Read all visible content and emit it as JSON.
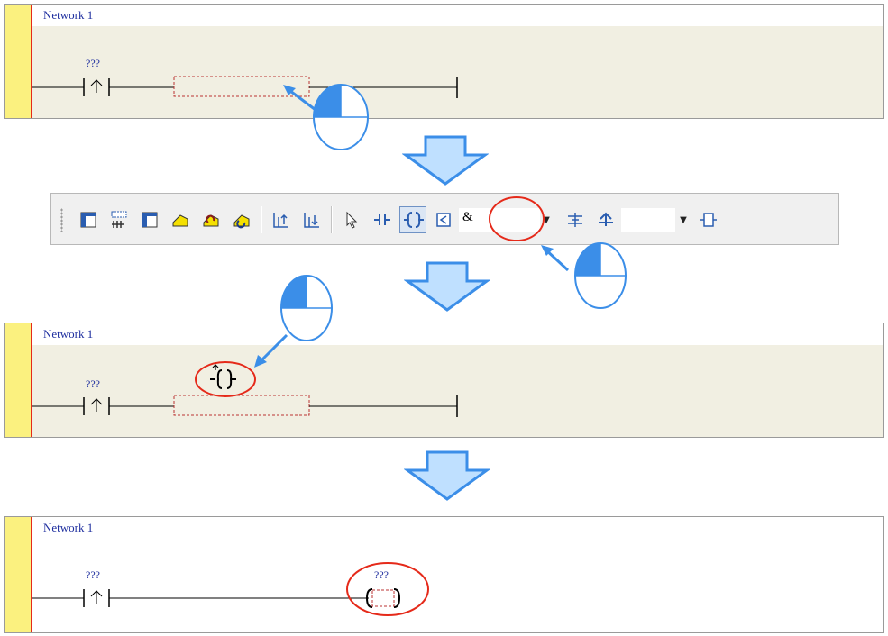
{
  "panel1": {
    "title": "Network 1",
    "contact_label": "???"
  },
  "toolbar": {
    "combo_value": "&",
    "buttons": [
      "network-icon",
      "insert-network-icon",
      "comment-icon",
      "branch-icon",
      "branch-up-icon",
      "branch-down-icon",
      "parallel-up-icon",
      "parallel-down-icon",
      "select-arrow-icon",
      "contact-icon",
      "coil-icon",
      "box-icon",
      "function-block-icon",
      "edge-icon",
      "jump-icon"
    ]
  },
  "panel2": {
    "title": "Network 1",
    "contact_label": "???",
    "drag_glyph": "{}"
  },
  "panel3": {
    "title": "Network 1",
    "contact_label": "???",
    "coil_label": "???"
  },
  "colors": {
    "arrow_fill": "#3b8ee8",
    "highlight_red": "#e52a1a",
    "label_blue": "#1f2f9f"
  }
}
